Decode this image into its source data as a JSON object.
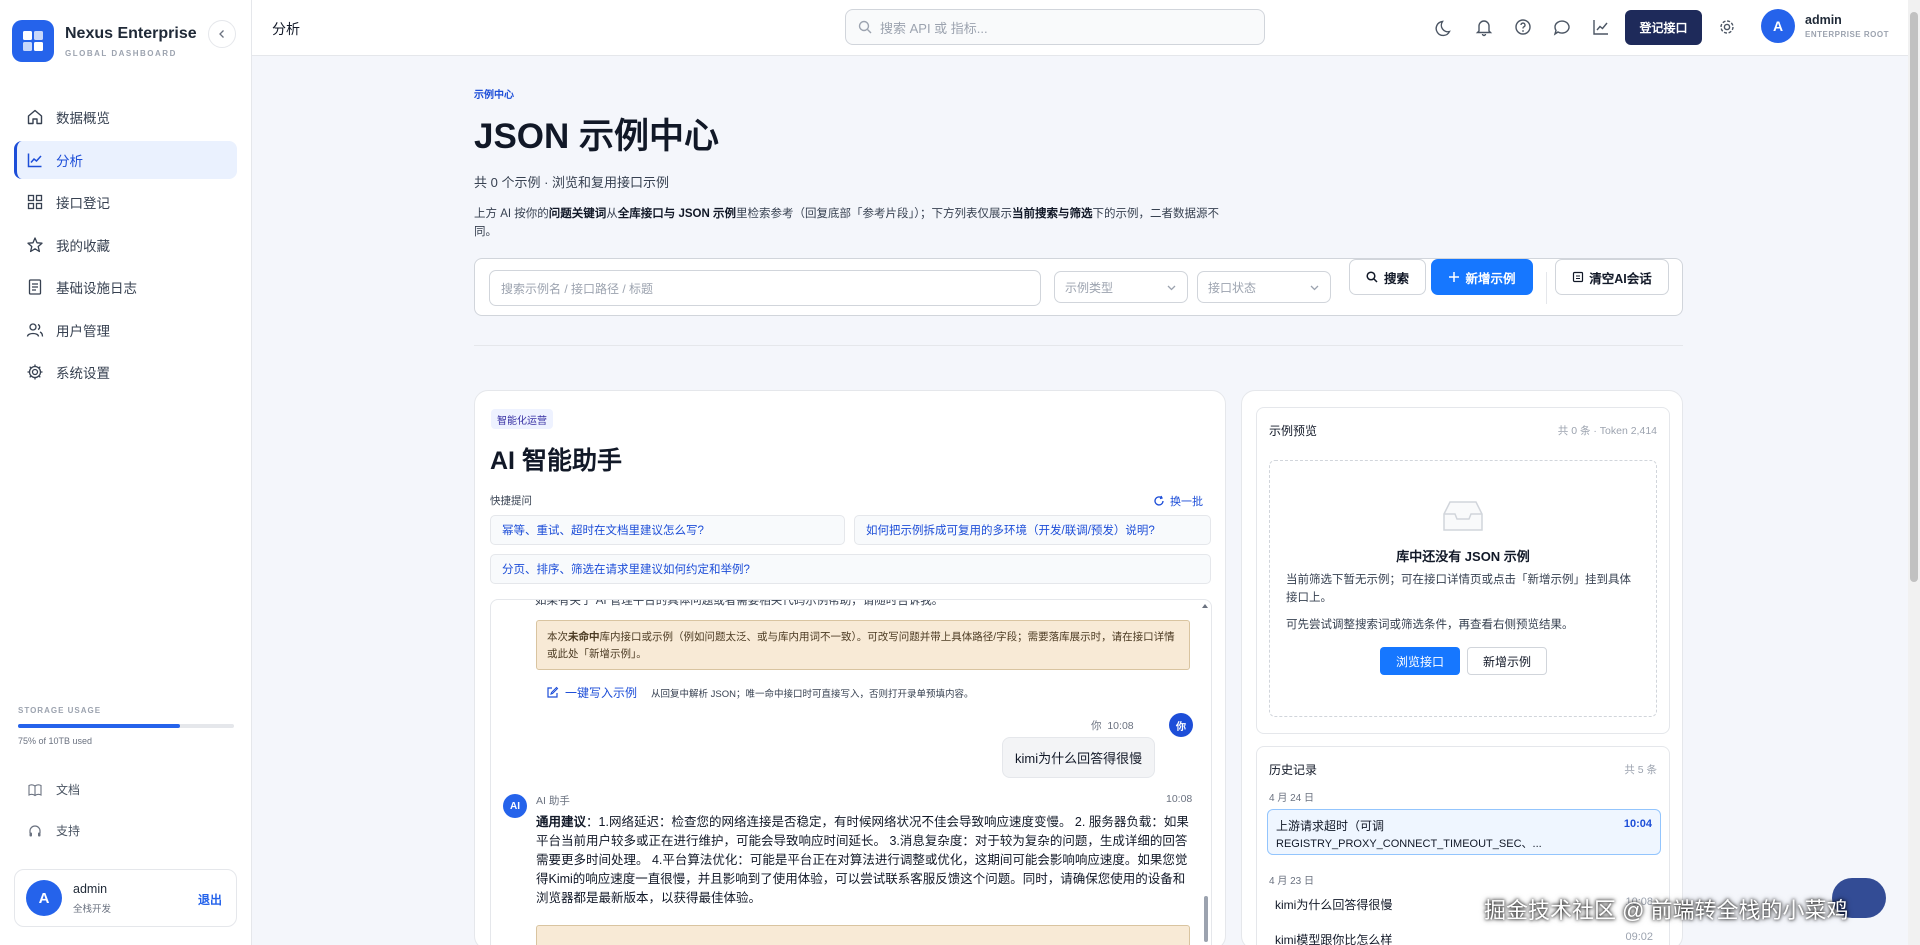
{
  "sidebar": {
    "brand_name": "Nexus Enterprise",
    "brand_sub": "GLOBAL DASHBOARD",
    "collapse_icon": "chevron-left-icon",
    "items": [
      {
        "label": "数据概览",
        "icon": "home-icon"
      },
      {
        "label": "分析",
        "icon": "chart-line-icon",
        "active": true
      },
      {
        "label": "接口登记",
        "icon": "grid-icon"
      },
      {
        "label": "我的收藏",
        "icon": "star-icon"
      },
      {
        "label": "基础设施日志",
        "icon": "document-icon"
      },
      {
        "label": "用户管理",
        "icon": "users-icon"
      },
      {
        "label": "系统设置",
        "icon": "gear-icon"
      }
    ],
    "storage": {
      "title": "STORAGE USAGE",
      "used_fraction": 0.75,
      "text": "75% of 10TB used"
    },
    "links": [
      {
        "label": "文档",
        "icon": "book-icon"
      },
      {
        "label": "支持",
        "icon": "headphones-icon"
      }
    ],
    "user": {
      "initial": "A",
      "name": "admin",
      "role": "全栈开发",
      "logout": "退出"
    }
  },
  "header": {
    "title": "分析",
    "search_placeholder": "搜索 API 或 指标...",
    "register_label": "登记接口",
    "user_initial": "A",
    "user_name": "admin",
    "user_role": "ENTERPRISE ROOT"
  },
  "main": {
    "breadcrumb": "示例中心",
    "title": "JSON 示例中心",
    "subtitle": "共 0 个示例 · 浏览和复用接口示例",
    "desc": {
      "p1": "上方 AI 按你的",
      "b1": "问题关键词",
      "p2": "从",
      "b2": "全库接口与 JSON 示例",
      "p3": "里检索参考（回复底部「参考片段」）；下方列表仅展示",
      "b3": "当前搜索与筛选",
      "p4": "下的示例，二者数据源不同。"
    },
    "filter": {
      "search_placeholder": "搜索示例名 / 接口路径 / 标题",
      "type_placeholder": "示例类型",
      "status_placeholder": "接口状态",
      "search_btn": "搜索",
      "new_btn": "新增示例",
      "clear_btn": "清空AI会话"
    }
  },
  "ai": {
    "tag": "智能化运营",
    "title": "AI 智能助手",
    "quick_label": "快捷提问",
    "refresh_label": "换一批",
    "chips": [
      "幂等、重试、超时在文档里建议怎么写?",
      "如何把示例拆成可复用的多环境（开发/联调/预发）说明?",
      "分页、排序、筛选在请求里建议如何约定和举例?"
    ],
    "chat": {
      "cut_text": "如果有关于 AI 管理平台的具体问题或者需要相关代码示例帮助，请随时告诉我。",
      "warning": "本次未命中库内接口或示例（例如问题太泛、或与库内用词不一致）。可改写问题并带上具体路径/字段；需要落库展示时，请在接口详情或此处「新增示例」。",
      "warning_bold": "未命中",
      "write_link": "一键写入示例",
      "write_note": "从回复中解析 JSON；唯一命中接口时可直接写入，否则打开录单预填内容。",
      "me_label": "你",
      "me_time": "10:08",
      "me_avatar": "你",
      "me_text": "kimi为什么回答得很慢",
      "ai_avatar": "AI",
      "ai_name": "AI 助手",
      "ai_time": "10:08",
      "ai_bold": "通用建议",
      "ai_text": "：1.网络延迟：检查您的网络连接是否稳定，有时候网络状况不佳会导致响应速度变慢。 2. 服务器负载：如果平台当前用户较多或正在进行维护，可能会导致响应时间延长。 3.消息复杂度：对于较为复杂的问题，生成详细的回答需要更多时间处理。 4.平台算法优化：可能是平台正在对算法进行调整或优化，这期间可能会影响响应速度。如果您觉得Kimi的响应速度一直很慢，并且影响到了使用体验，可以尝试联系客服反馈这个问题。同时，请确保您使用的设备和浏览器都是最新版本，以获得最佳体验。"
    }
  },
  "preview": {
    "title": "示例预览",
    "meta": "共 0 条 · Token 2,414",
    "empty_title": "库中还没有 JSON 示例",
    "empty_desc": "当前筛选下暂无示例；可在接口详情页或点击「新增示例」挂到具体接口上。",
    "empty_desc2": "可先尝试调整搜索词或筛选条件，再查看右侧预览结果。",
    "browse_btn": "浏览接口",
    "new_btn": "新增示例"
  },
  "history": {
    "title": "历史记录",
    "count": "共 5 条",
    "groups": [
      {
        "date": "4 月 24 日",
        "items": [
          {
            "title": "上游请求超时（可调",
            "sub": "REGISTRY_PROXY_CONNECT_TIMEOUT_SEC、...",
            "time": "10:04"
          }
        ]
      },
      {
        "date": "4 月 23 日",
        "items": [
          {
            "title": "kimi为什么回答得很慢",
            "time": "10:08"
          },
          {
            "title": "kimi模型跟你比怎么样",
            "time": "09:02"
          }
        ]
      }
    ]
  },
  "watermark": "掘金技术社区 @ 前端转全栈的小菜鸡"
}
